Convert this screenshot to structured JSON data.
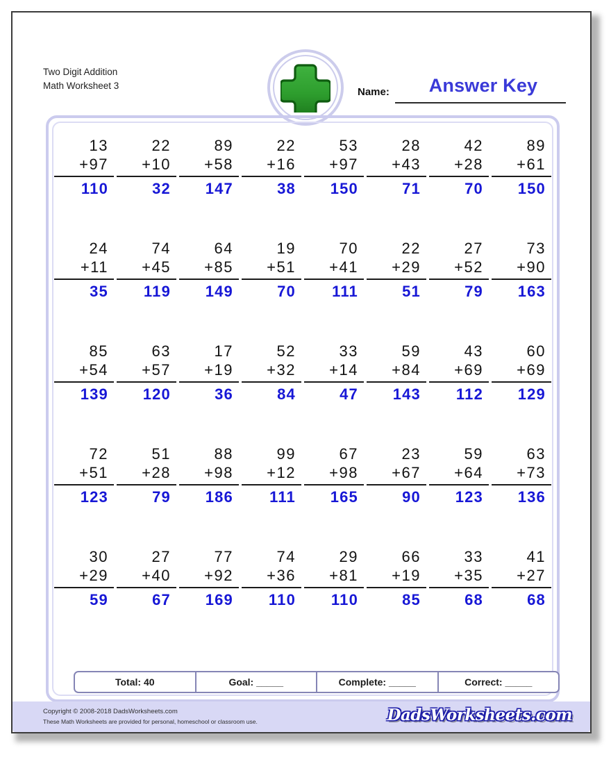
{
  "worksheet": {
    "title_line1": "Two Digit Addition",
    "title_line2": "Math Worksheet 3",
    "name_label": "Name:",
    "name_value": "Answer Key",
    "logo_icon": "green-plus-icon"
  },
  "colors": {
    "answer_blue": "#1717d6",
    "answer_key_blue": "#3a3ad8",
    "frame_lavender": "#cbcbee",
    "footer_band": "#d8d8f5",
    "plus_green": "#2e9e2e",
    "plus_green_dark": "#0f5c10"
  },
  "scorebar": {
    "total": "Total: 40",
    "goal": "Goal: _____",
    "complete": "Complete: _____",
    "correct": "Correct: _____"
  },
  "footer": {
    "copyright": "Copyright © 2008-2018 DadsWorksheets.com",
    "usage": "These Math Worksheets are provided for personal, homeschool or classroom use.",
    "brand": "DadsWorksheets.com"
  },
  "problems": [
    {
      "a": "13",
      "b": "+97",
      "sum": "110"
    },
    {
      "a": "22",
      "b": "+10",
      "sum": "32"
    },
    {
      "a": "89",
      "b": "+58",
      "sum": "147"
    },
    {
      "a": "22",
      "b": "+16",
      "sum": "38"
    },
    {
      "a": "53",
      "b": "+97",
      "sum": "150"
    },
    {
      "a": "28",
      "b": "+43",
      "sum": "71"
    },
    {
      "a": "42",
      "b": "+28",
      "sum": "70"
    },
    {
      "a": "89",
      "b": "+61",
      "sum": "150"
    },
    {
      "a": "24",
      "b": "+11",
      "sum": "35"
    },
    {
      "a": "74",
      "b": "+45",
      "sum": "119"
    },
    {
      "a": "64",
      "b": "+85",
      "sum": "149"
    },
    {
      "a": "19",
      "b": "+51",
      "sum": "70"
    },
    {
      "a": "70",
      "b": "+41",
      "sum": "111"
    },
    {
      "a": "22",
      "b": "+29",
      "sum": "51"
    },
    {
      "a": "27",
      "b": "+52",
      "sum": "79"
    },
    {
      "a": "73",
      "b": "+90",
      "sum": "163"
    },
    {
      "a": "85",
      "b": "+54",
      "sum": "139"
    },
    {
      "a": "63",
      "b": "+57",
      "sum": "120"
    },
    {
      "a": "17",
      "b": "+19",
      "sum": "36"
    },
    {
      "a": "52",
      "b": "+32",
      "sum": "84"
    },
    {
      "a": "33",
      "b": "+14",
      "sum": "47"
    },
    {
      "a": "59",
      "b": "+84",
      "sum": "143"
    },
    {
      "a": "43",
      "b": "+69",
      "sum": "112"
    },
    {
      "a": "60",
      "b": "+69",
      "sum": "129"
    },
    {
      "a": "72",
      "b": "+51",
      "sum": "123"
    },
    {
      "a": "51",
      "b": "+28",
      "sum": "79"
    },
    {
      "a": "88",
      "b": "+98",
      "sum": "186"
    },
    {
      "a": "99",
      "b": "+12",
      "sum": "111"
    },
    {
      "a": "67",
      "b": "+98",
      "sum": "165"
    },
    {
      "a": "23",
      "b": "+67",
      "sum": "90"
    },
    {
      "a": "59",
      "b": "+64",
      "sum": "123"
    },
    {
      "a": "63",
      "b": "+73",
      "sum": "136"
    },
    {
      "a": "30",
      "b": "+29",
      "sum": "59"
    },
    {
      "a": "27",
      "b": "+40",
      "sum": "67"
    },
    {
      "a": "77",
      "b": "+92",
      "sum": "169"
    },
    {
      "a": "74",
      "b": "+36",
      "sum": "110"
    },
    {
      "a": "29",
      "b": "+81",
      "sum": "110"
    },
    {
      "a": "66",
      "b": "+19",
      "sum": "85"
    },
    {
      "a": "33",
      "b": "+35",
      "sum": "68"
    },
    {
      "a": "41",
      "b": "+27",
      "sum": "68"
    }
  ]
}
